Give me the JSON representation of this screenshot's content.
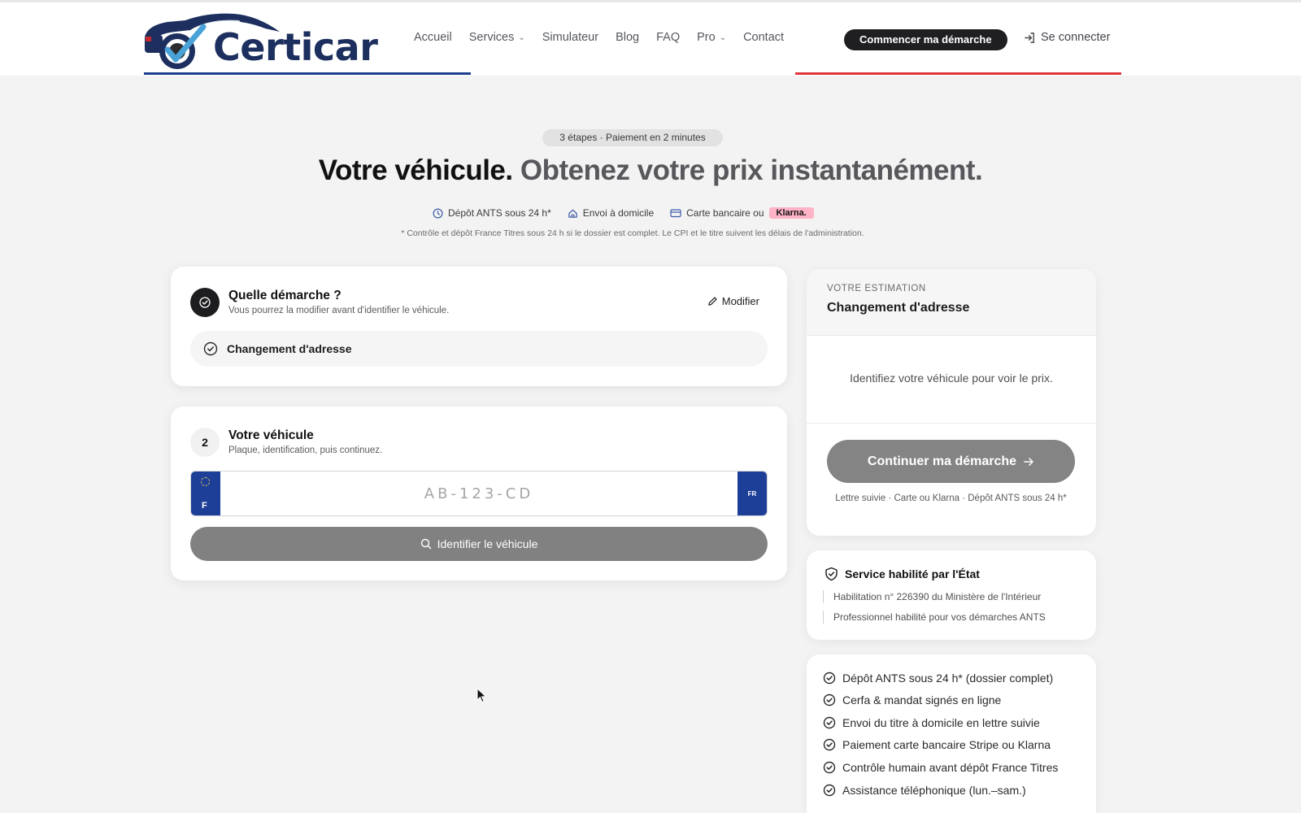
{
  "header": {
    "logo_text": "Certicar",
    "nav": [
      {
        "label": "Accueil",
        "dropdown": false
      },
      {
        "label": "Services",
        "dropdown": true
      },
      {
        "label": "Simulateur",
        "dropdown": false
      },
      {
        "label": "Blog",
        "dropdown": false
      },
      {
        "label": "FAQ",
        "dropdown": false
      },
      {
        "label": "Pro",
        "dropdown": true
      },
      {
        "label": "Contact",
        "dropdown": false
      }
    ],
    "cta_label": "Commencer ma démarche",
    "login_label": "Se connecter"
  },
  "hero": {
    "pill": "3 étapes · Paiement en 2 minutes",
    "title_part1": "Votre véhicule.",
    "title_part2": "Obtenez votre prix instantanément.",
    "features": {
      "ants": "Dépôt ANTS sous 24 h*",
      "home": "Envoi à domicile",
      "card": "Carte bancaire ou",
      "klarna": "Klarna."
    },
    "footnote": "* Contrôle et dépôt France Titres sous 24 h si le dossier est complet. Le CPI et le titre suivent les délais de l'administration."
  },
  "step1": {
    "title": "Quelle démarche ?",
    "subtitle": "Vous pourrez la modifier avant d'identifier le véhicule.",
    "modify_label": "Modifier",
    "selected": "Changement d'adresse"
  },
  "step2": {
    "number": "2",
    "title": "Votre véhicule",
    "subtitle": "Plaque, identification, puis continuez.",
    "plate_country_left": "F",
    "plate_country_right": "FR",
    "plate_placeholder": "AB-123-CD",
    "plate_value": "",
    "identify_label": "Identifier le véhicule"
  },
  "estimate": {
    "label": "VOTRE ESTIMATION",
    "title": "Changement d'adresse",
    "hint": "Identifiez votre véhicule pour voir le prix.",
    "continue_label": "Continuer ma démarche",
    "meta": "Lettre suivie · Carte ou Klarna · Dépôt ANTS sous 24 h*"
  },
  "state_service": {
    "title": "Service habilité par l'État",
    "lines": [
      "Habilitation n° 226390 du Ministère de l'Intérieur",
      "Professionnel habilité pour vos démarches ANTS"
    ]
  },
  "benefits": [
    "Dépôt ANTS sous 24 h* (dossier complet)",
    "Cerfa & mandat signés en ligne",
    "Envoi du titre à domicile en lettre suivie",
    "Paiement carte bancaire Stripe ou Klarna",
    "Contrôle humain avant dépôt France Titres",
    "Assistance téléphonique (lun.–sam.)"
  ],
  "colors": {
    "brand_navy": "#1c2f5e",
    "accent_blue": "#1c3f8f",
    "accent_red": "#e0363d",
    "klarna_pink": "#ffb3c7",
    "disabled_button": "#818181"
  },
  "icons": {
    "logo": "car-with-checkmark-logo",
    "login": "sign-in-icon",
    "ants": "clock-icon",
    "home": "home-icon",
    "card": "credit-card-icon",
    "modify": "pencil-icon",
    "search": "search-icon",
    "arrow": "arrow-right-icon",
    "shield": "shield-check-icon",
    "check": "check-circle-icon"
  }
}
